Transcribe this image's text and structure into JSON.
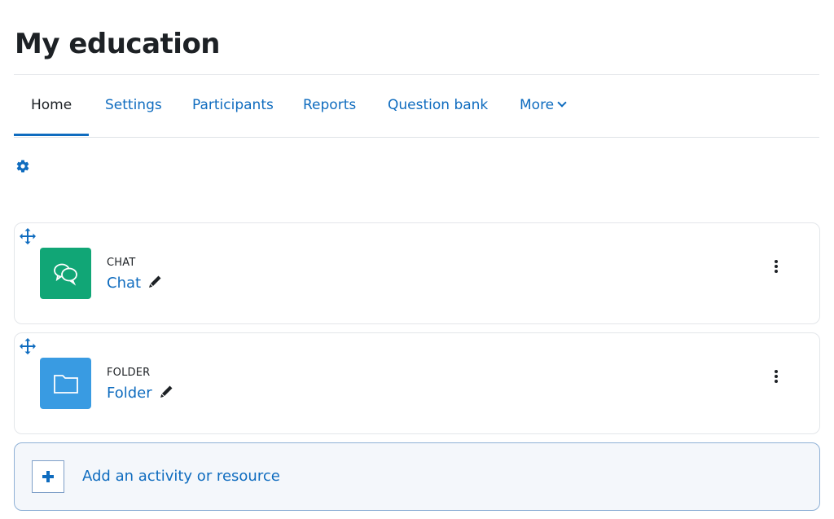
{
  "page": {
    "title": "My education"
  },
  "nav": {
    "tabs": [
      {
        "label": "Home",
        "active": true
      },
      {
        "label": "Settings",
        "active": false
      },
      {
        "label": "Participants",
        "active": false
      },
      {
        "label": "Reports",
        "active": false
      },
      {
        "label": "Question bank",
        "active": false
      },
      {
        "label": "More",
        "active": false,
        "icon": "chevron-down-icon"
      }
    ]
  },
  "settings": {
    "icon": "gear-icon"
  },
  "activities": [
    {
      "modname": "CHAT",
      "name": "Chat",
      "icon": "chat-icon",
      "icon_color": "#11a676"
    },
    {
      "modname": "FOLDER",
      "name": "Folder",
      "icon": "folder-icon",
      "icon_color": "#399be2"
    }
  ],
  "add_activity": {
    "label": "Add an activity or resource",
    "icon": "plus-icon"
  },
  "colors": {
    "accent": "#0f6cbf",
    "text": "#1d2125",
    "border": "#dee2e6"
  }
}
